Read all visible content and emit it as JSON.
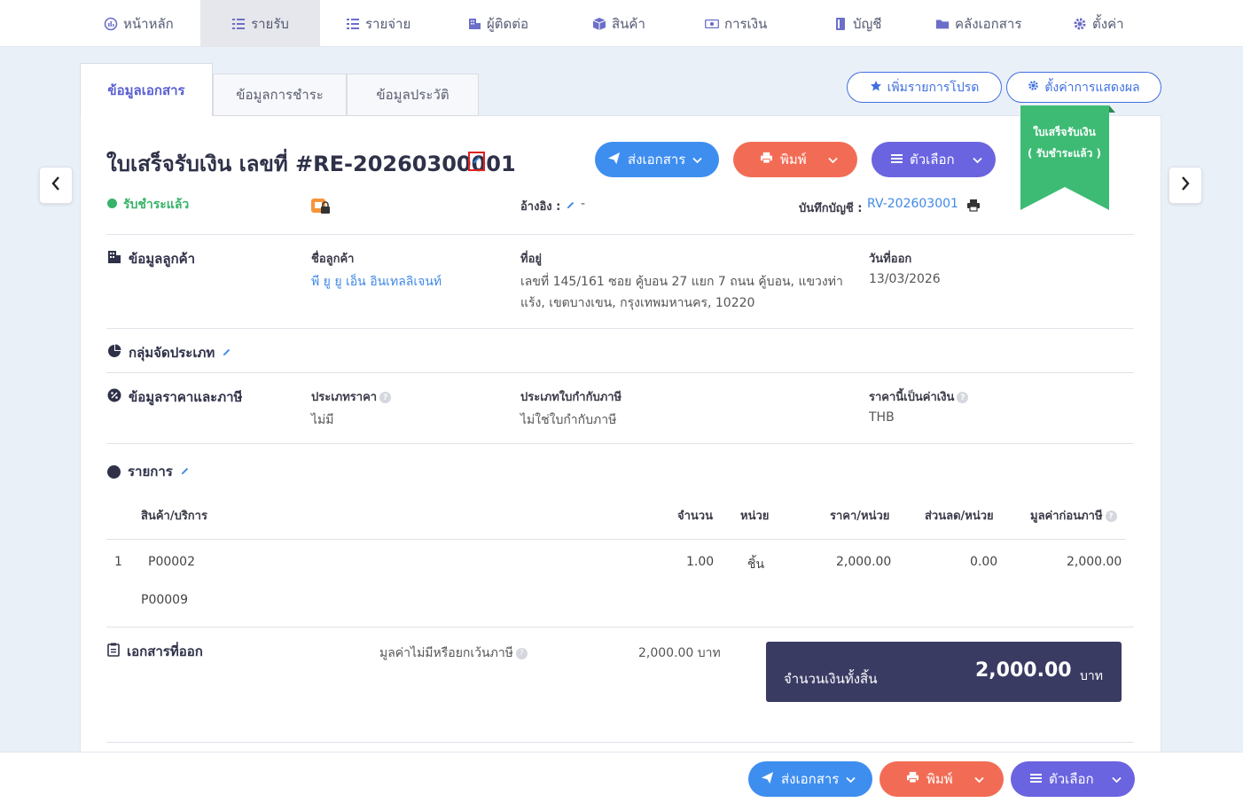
{
  "nav": {
    "items": [
      {
        "label": "หน้าหลัก",
        "icon": "dashboard-icon"
      },
      {
        "label": "รายรับ",
        "icon": "income-icon",
        "active": true
      },
      {
        "label": "รายจ่าย",
        "icon": "expense-icon"
      },
      {
        "label": "ผู้ติดต่อ",
        "icon": "contacts-icon"
      },
      {
        "label": "สินค้า",
        "icon": "box-icon"
      },
      {
        "label": "การเงิน",
        "icon": "money-icon"
      },
      {
        "label": "บัญชี",
        "icon": "ledger-icon"
      },
      {
        "label": "คลังเอกสาร",
        "icon": "folder-icon"
      },
      {
        "label": "ตั้งค่า",
        "icon": "gear-icon"
      }
    ]
  },
  "tabs": [
    "ข้อมูลเอกสาร",
    "ข้อมูลการชำระ",
    "ข้อมูลประวัติ"
  ],
  "top_buttons": {
    "favorite": "เพิ่มรายการโปรด",
    "display_settings": "ตั้งค่าการแสดงผล"
  },
  "doc": {
    "title": "ใบเสร็จรับเงิน เลขที่ #RE-20260300001",
    "status": "รับชำระแล้ว",
    "ref_label": "อ้างอิง :",
    "ref_value": "-",
    "account_label": "บันทึกบัญชี :",
    "account_value": "RV-202603001"
  },
  "actions": {
    "send": "ส่งเอกสาร",
    "print": "พิมพ์",
    "options": "ตัวเลือก"
  },
  "ribbon": {
    "line1": "ใบเสร็จรับเงิน",
    "line2": "( รับชำระแล้ว )"
  },
  "customer": {
    "section": "ข้อมูลลูกค้า",
    "name_label": "ชื่อลูกค้า",
    "name": "พี ยู ยู เอ็น อินเทลลิเจนท์",
    "address_label": "ที่อยู่",
    "address_line1": "เลขที่ 145/161 ซอย คู้บอน 27 แยก 7 ถนน คู้บอน, แขวงท่า",
    "address_line2": "แร้ง, เขตบางเขน, กรุงเทพมหานคร, 10220",
    "date_label": "วันที่ออก",
    "date": "13/03/2026"
  },
  "category": {
    "section": "กลุ่มจัดประเภท"
  },
  "pricing": {
    "section": "ข้อมูลราคาและภาษี",
    "price_type_label": "ประเภทราคา",
    "price_type": "ไม่มี",
    "tax_type_label": "ประเภทใบกำกับภาษี",
    "tax_type": "ไม่ใช่ใบกำกับภาษี",
    "currency_label": "ราคานี้เป็นค่าเงิน",
    "currency": "THB"
  },
  "items": {
    "section": "รายการ",
    "headers": [
      "สินค้า/บริการ",
      "จำนวน",
      "หน่วย",
      "ราคา/หน่วย",
      "ส่วนลด/หน่วย",
      "มูลค่าก่อนภาษี"
    ],
    "rows": [
      {
        "no": "1",
        "code": "P00002",
        "desc": "P00009",
        "qty": "1.00",
        "unit": "ชิ้น",
        "price": "2,000.00",
        "discount": "0.00",
        "amount": "2,000.00"
      }
    ]
  },
  "summary": {
    "section": "เอกสารที่ออก",
    "nontax_label": "มูลค่าไม่มีหรือยกเว้นภาษี",
    "nontax_value": "2,000.00 บาท",
    "total_label": "จำนวนเงินทั้งสิ้น",
    "total_value": "2,000.00",
    "total_unit": "บาท"
  },
  "colors": {
    "send": "#3e8ef0",
    "print": "#f26c55",
    "options": "#6a64e0",
    "ribbon": "#3dbb74",
    "status": "#37b36a",
    "total_bg": "#393b63"
  }
}
